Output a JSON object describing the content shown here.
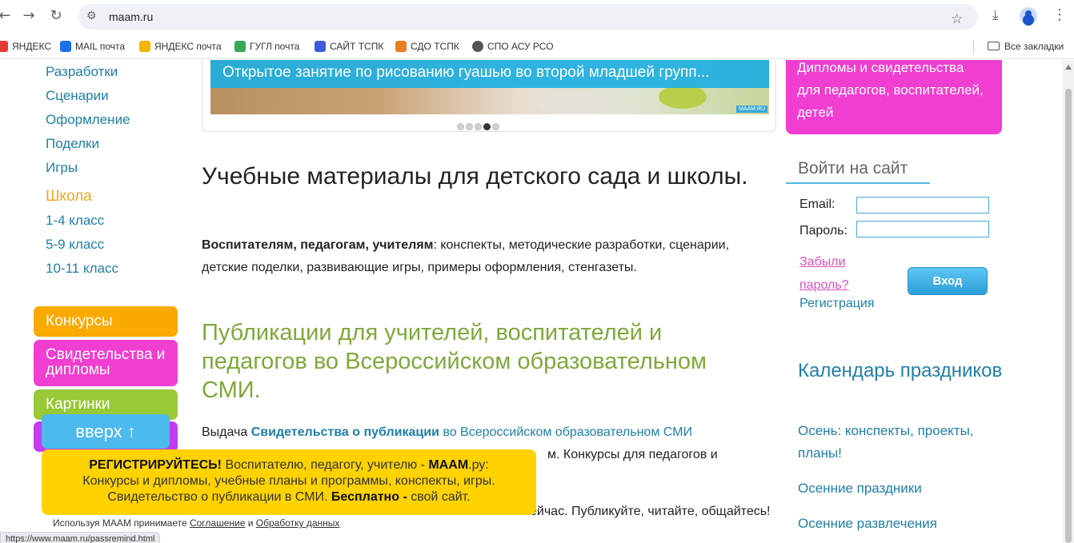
{
  "browser": {
    "url": "maam.ru",
    "bookmarks": [
      {
        "label": "ЯНДЕКС",
        "color": "#e53935"
      },
      {
        "label": "MAIL почта",
        "color": "#1a73e8"
      },
      {
        "label": "ЯНДЕКС почта",
        "color": "#f4b400"
      },
      {
        "label": "ГУГЛ почта",
        "color": "#34a853"
      },
      {
        "label": "САЙТ ТСПК",
        "color": "#3b5bdb"
      },
      {
        "label": "СДО ТСПК",
        "color": "#e67e22"
      },
      {
        "label": "СПО АСУ РСО",
        "color": "#555555"
      }
    ],
    "all_bookmarks": "Все закладки",
    "status_url": "https://www.maam.ru/passremind.html"
  },
  "left_nav": {
    "items": [
      "Разработки",
      "Сценарии",
      "Оформление",
      "Поделки",
      "Игры"
    ],
    "school_heading": "Школа",
    "school_items": [
      "1-4 класс",
      "5-9 класс",
      "10-11 класс"
    ],
    "categories": {
      "contests": "Конкурсы",
      "certificates": "Свидетельства и дипломы",
      "pictures": "Картинки"
    }
  },
  "slider": {
    "caption": "Открытое занятие по рисованию гуашью во второй младшей групп...",
    "logo": "MAAM.RU",
    "dots_total": 5,
    "active_dot": 4
  },
  "main": {
    "heading": "Учебные материалы для детского сада и школы.",
    "intro_bold": "Воспитателям, педагогам, учителям",
    "intro_rest": ": конспекты, методические разработки, сценарии, детские поделки, развивающие игры, примеры оформления, стенгазеты.",
    "pub_heading": "Публикации для учителей, воспитателей и педагогов во Всероссийском образовательном СМИ.",
    "para2_start": "Выдача ",
    "para2_link_bold": "Свидетельства о публикации",
    "para2_link_rest": " во Всероссийском образовательном СМИ",
    "para2_tail": "м. Конкурсы для педагогов и",
    "para3_tail": "ейчас. Публикуйте, читайте, общайтесь!"
  },
  "right": {
    "promo_text": "Дипломы и свидетельства для педагогов, воспитателей, детей",
    "login_title": "Войти на сайт",
    "email_label": "Email:",
    "password_label": "Пароль:",
    "forgot_password": "Забыли пароль?",
    "register": "Регистрация",
    "login_button": "Вход",
    "calendar_title": "Календарь праздников",
    "calendar_links": [
      "Осень: конспекты, проекты, планы!",
      "Осенние праздники",
      "Осенние развлечения"
    ]
  },
  "overlay": {
    "up_button": "вверх ↑",
    "banner_bold1": "РЕГИСТРИРУЙТЕСЬ!",
    "banner_text1": " Воспитателю, педагогу, учителю - ",
    "banner_bold2": "МААМ",
    "banner_text2": ".ру:",
    "banner_line2": "Конкурсы и дипломы, учебные планы и программы, конспекты, игры.",
    "banner_line3_start": "Свидетельство о публикации в СМИ. ",
    "banner_bold3": "Бесплатно -",
    "banner_line3_end": " свой сайт.",
    "consent_start": "Используя МААМ принимаете ",
    "consent_link1": "Соглашение",
    "consent_mid": " и ",
    "consent_link2": "Обработку данных"
  }
}
